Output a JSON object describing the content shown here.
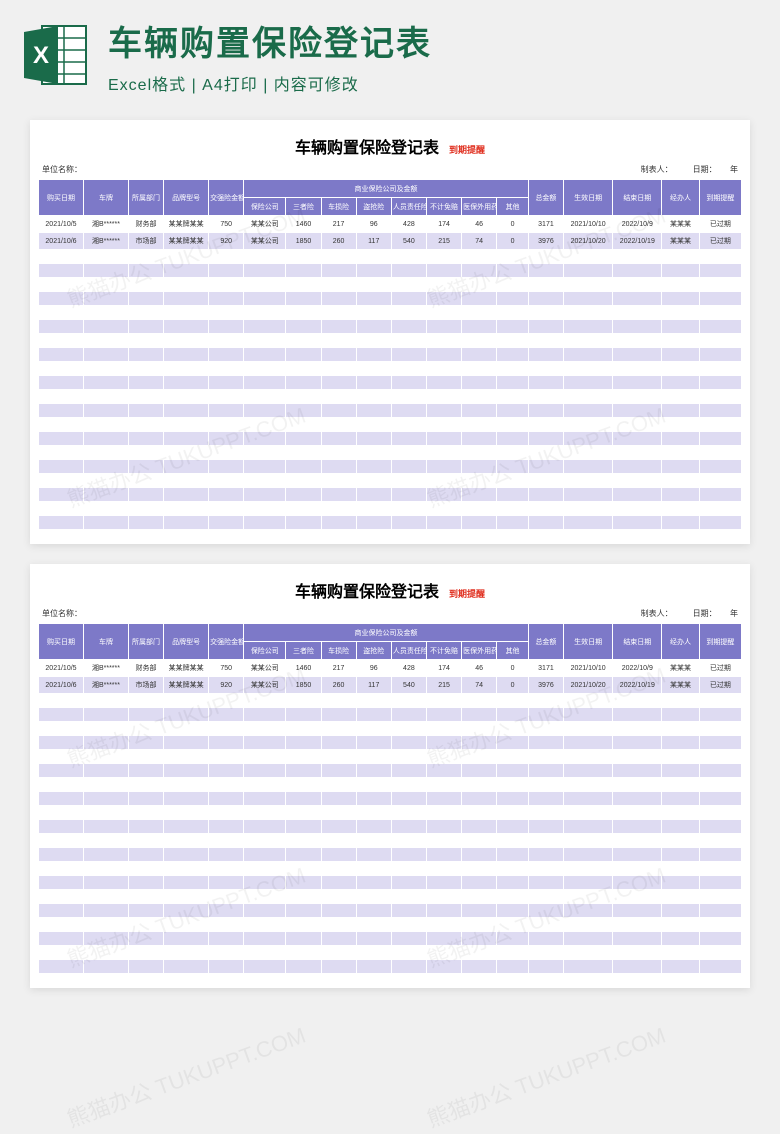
{
  "banner": {
    "title": "车辆购置保险登记表",
    "subtitle": "Excel格式 | A4打印 | 内容可修改"
  },
  "watermark_text": "熊猫办公 TUKUPPT.COM",
  "sheet": {
    "title": "车辆购置保险登记表",
    "tag": "到期提醒",
    "meta": {
      "unit_label": "单位名称：",
      "maker_label": "制表人：",
      "date_label": "日期：",
      "year_label": "年"
    },
    "headers": {
      "c1": "购买日期",
      "c2": "车牌",
      "c3": "所属部门",
      "c4": "品牌型号",
      "c5": "交强险金额",
      "group": "商业保险公司及金额",
      "g1": "保险公司",
      "g2": "三者险",
      "g3": "车损险",
      "g4": "盗抢险",
      "g5": "人员责任险",
      "g6": "不计免赔",
      "g7": "医保外用药",
      "g8": "其他",
      "c6": "总金额",
      "c7": "生效日期",
      "c8": "结束日期",
      "c9": "经办人",
      "c10": "到期提醒"
    },
    "rows": [
      {
        "date": "2021/10/5",
        "plate": "湘B******",
        "dept": "财务部",
        "model": "某某牌某某",
        "jq": "750",
        "company": "某某公司",
        "sz": "1460",
        "cs": "217",
        "dq": "96",
        "ry": "428",
        "bj": "174",
        "yb": "46",
        "other": "0",
        "total": "3171",
        "start": "2021/10/10",
        "end": "2022/10/9",
        "agent": "某某某",
        "remind": "已过期"
      },
      {
        "date": "2021/10/6",
        "plate": "湘B******",
        "dept": "市场部",
        "model": "某某牌某某",
        "jq": "920",
        "company": "某某公司",
        "sz": "1850",
        "cs": "260",
        "dq": "117",
        "ry": "540",
        "bj": "215",
        "yb": "74",
        "other": "0",
        "total": "3976",
        "start": "2021/10/20",
        "end": "2022/10/19",
        "agent": "某某某",
        "remind": "已过期"
      }
    ],
    "empty_rows": 20
  },
  "chart_data": {
    "type": "table",
    "title": "车辆购置保险登记表",
    "columns": [
      "购买日期",
      "车牌",
      "所属部门",
      "品牌型号",
      "交强险金额",
      "保险公司",
      "三者险",
      "车损险",
      "盗抢险",
      "人员责任险",
      "不计免赔",
      "医保外用药",
      "其他",
      "总金额",
      "生效日期",
      "结束日期",
      "经办人",
      "到期提醒"
    ],
    "rows": [
      [
        "2021/10/5",
        "湘B******",
        "财务部",
        "某某牌某某",
        750,
        "某某公司",
        1460,
        217,
        96,
        428,
        174,
        46,
        0,
        3171,
        "2021/10/10",
        "2022/10/9",
        "某某某",
        "已过期"
      ],
      [
        "2021/10/6",
        "湘B******",
        "市场部",
        "某某牌某某",
        920,
        "某某公司",
        1850,
        260,
        117,
        540,
        215,
        74,
        0,
        3976,
        "2021/10/20",
        "2022/10/19",
        "某某某",
        "已过期"
      ]
    ]
  }
}
